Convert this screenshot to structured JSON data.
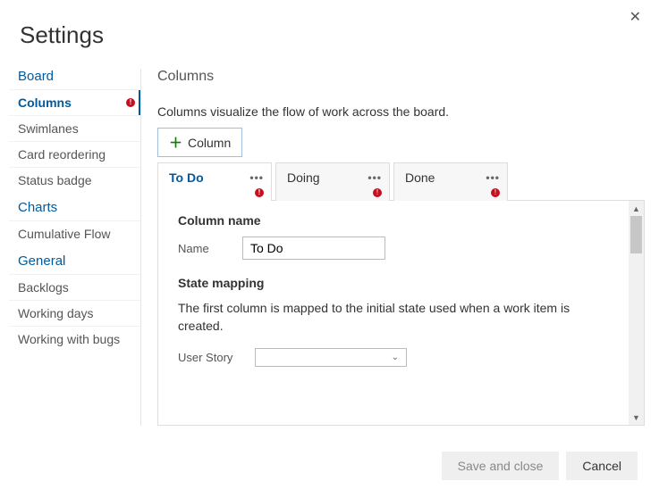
{
  "dialog": {
    "title": "Settings"
  },
  "sidebar": {
    "groups": [
      {
        "title": "Board",
        "items": [
          {
            "label": "Columns",
            "active": true,
            "error": true
          },
          {
            "label": "Swimlanes"
          },
          {
            "label": "Card reordering"
          },
          {
            "label": "Status badge"
          }
        ]
      },
      {
        "title": "Charts",
        "items": [
          {
            "label": "Cumulative Flow"
          }
        ]
      },
      {
        "title": "General",
        "items": [
          {
            "label": "Backlogs"
          },
          {
            "label": "Working days"
          },
          {
            "label": "Working with bugs"
          }
        ]
      }
    ]
  },
  "panel": {
    "title": "Columns",
    "description": "Columns visualize the flow of work across the board.",
    "add_button": "Column",
    "tabs": [
      {
        "label": "To Do",
        "active": true,
        "error": true
      },
      {
        "label": "Doing",
        "error": true
      },
      {
        "label": "Done",
        "error": true
      }
    ],
    "column_name_section": "Column name",
    "name_label": "Name",
    "name_value": "To Do",
    "state_mapping_section": "State mapping",
    "state_mapping_desc": "The first column is mapped to the initial state used when a work item is created.",
    "user_story_label": "User Story",
    "user_story_value": ""
  },
  "footer": {
    "save": "Save and close",
    "cancel": "Cancel"
  }
}
